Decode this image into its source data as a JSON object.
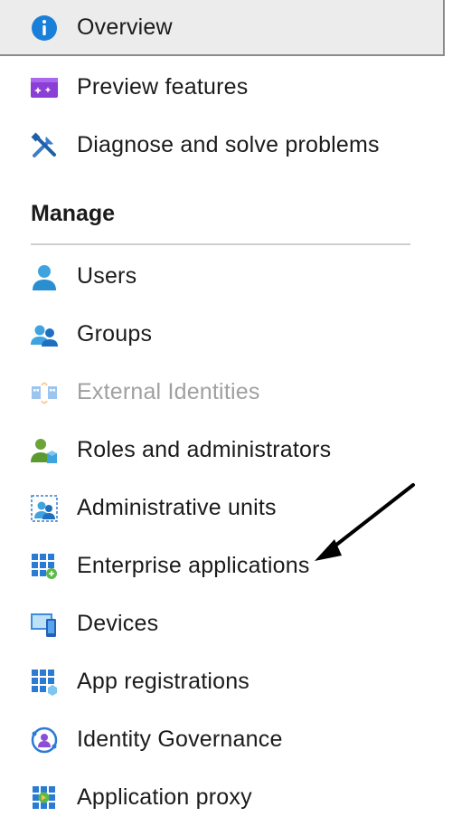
{
  "top_items": [
    {
      "label": "Overview",
      "icon": "info-icon",
      "selected": true
    },
    {
      "label": "Preview features",
      "icon": "preview-features-icon"
    },
    {
      "label": "Diagnose and solve problems",
      "icon": "tools-icon"
    }
  ],
  "manage": {
    "title": "Manage",
    "items": [
      {
        "label": "Users",
        "icon": "user-icon"
      },
      {
        "label": "Groups",
        "icon": "groups-icon"
      },
      {
        "label": "External Identities",
        "icon": "external-identities-icon",
        "disabled": true
      },
      {
        "label": "Roles and administrators",
        "icon": "roles-icon"
      },
      {
        "label": "Administrative units",
        "icon": "administrative-units-icon"
      },
      {
        "label": "Enterprise applications",
        "icon": "enterprise-apps-icon"
      },
      {
        "label": "Devices",
        "icon": "devices-icon"
      },
      {
        "label": "App registrations",
        "icon": "app-registrations-icon"
      },
      {
        "label": "Identity Governance",
        "icon": "identity-governance-icon"
      },
      {
        "label": "Application proxy",
        "icon": "application-proxy-icon"
      }
    ]
  },
  "colors": {
    "selected_bg": "#ececec",
    "disabled_text": "#a0a0a0",
    "azure_blue": "#0078d4"
  }
}
